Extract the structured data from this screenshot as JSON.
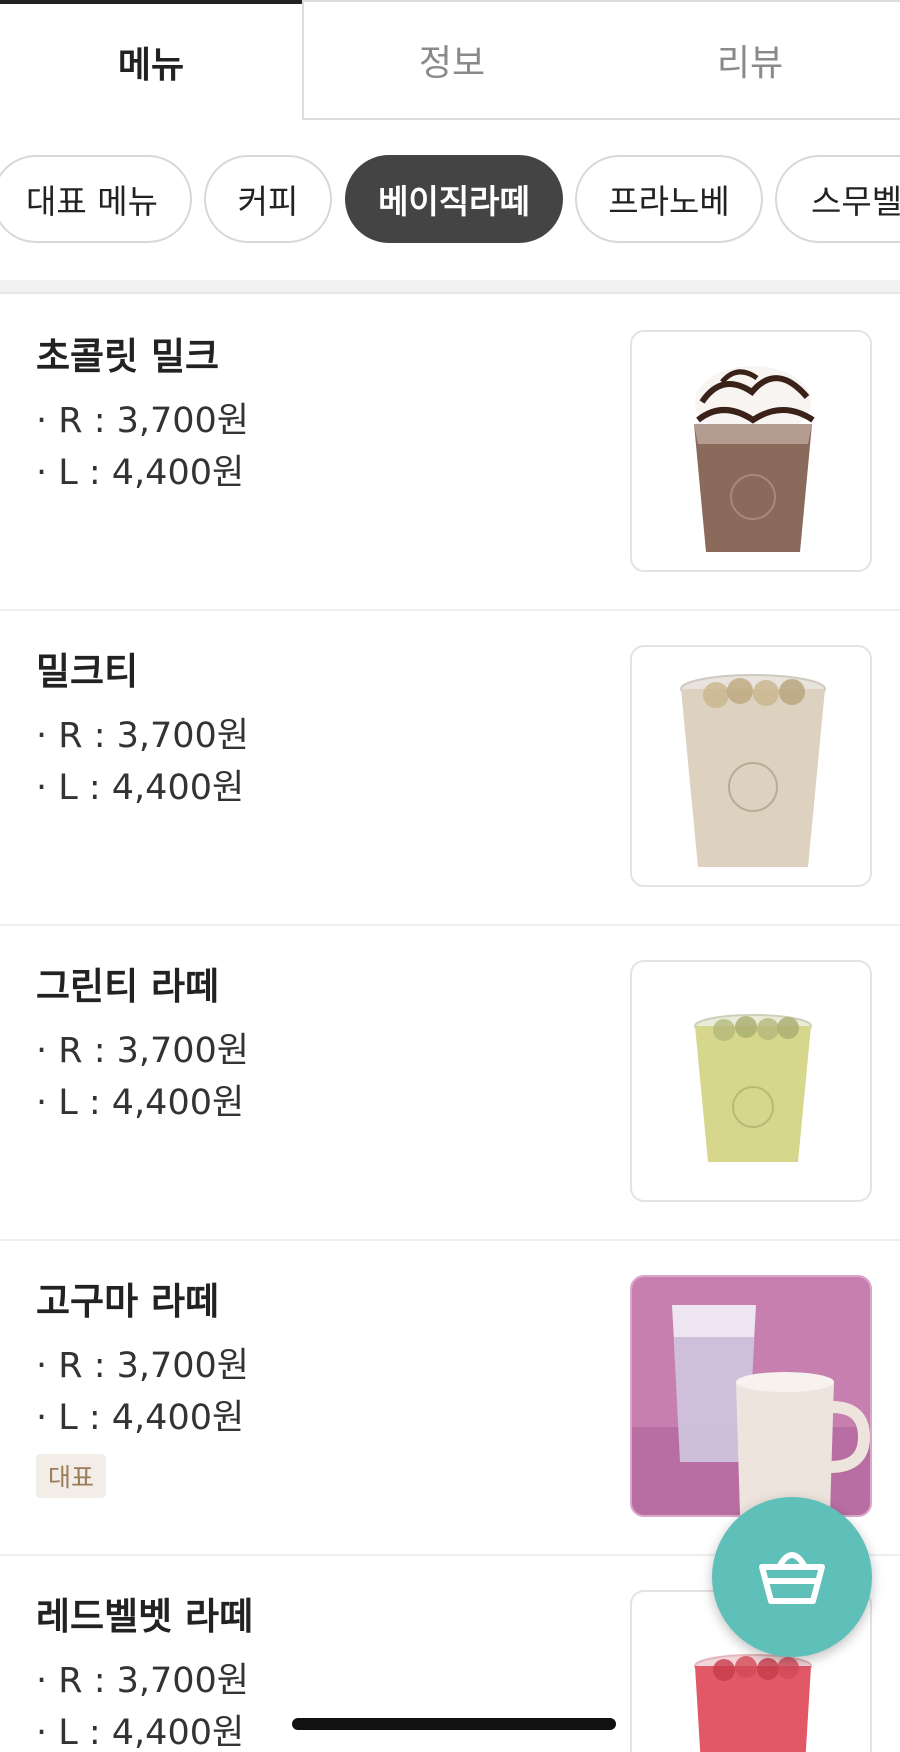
{
  "tabs": [
    {
      "label": "메뉴",
      "active": true
    },
    {
      "label": "정보",
      "active": false
    },
    {
      "label": "리뷰",
      "active": false
    }
  ],
  "categories": [
    {
      "label": "대표 메뉴",
      "active": false
    },
    {
      "label": "커피",
      "active": false
    },
    {
      "label": "베이직라떼",
      "active": true
    },
    {
      "label": "프라노베",
      "active": false
    },
    {
      "label": "스무벨",
      "active": false
    }
  ],
  "menu": [
    {
      "name": "초콜릿 밀크",
      "price_r": "· R : 3,700원",
      "price_l": "· L : 4,400원",
      "badge": null,
      "image": "chocolate-milk-image"
    },
    {
      "name": "밀크티",
      "price_r": "· R : 3,700원",
      "price_l": "· L : 4,400원",
      "badge": null,
      "image": "milk-tea-image"
    },
    {
      "name": "그린티 라떼",
      "price_r": "· R : 3,700원",
      "price_l": "· L : 4,400원",
      "badge": null,
      "image": "green-tea-latte-image"
    },
    {
      "name": "고구마 라떼",
      "price_r": "· R : 3,700원",
      "price_l": "· L : 4,400원",
      "badge": "대표",
      "image": "sweet-potato-latte-image"
    },
    {
      "name": "레드벨벳 라떼",
      "price_r": "· R : 3,700원",
      "price_l": "· L : 4,400원",
      "badge": null,
      "image": "red-velvet-latte-image"
    }
  ],
  "cart_button": {
    "icon": "basket-icon",
    "color": "#5fbfb9"
  },
  "colors": {
    "accent_dark": "#444444",
    "badge_bg": "#f3ede7",
    "badge_text": "#9a7b5a"
  }
}
